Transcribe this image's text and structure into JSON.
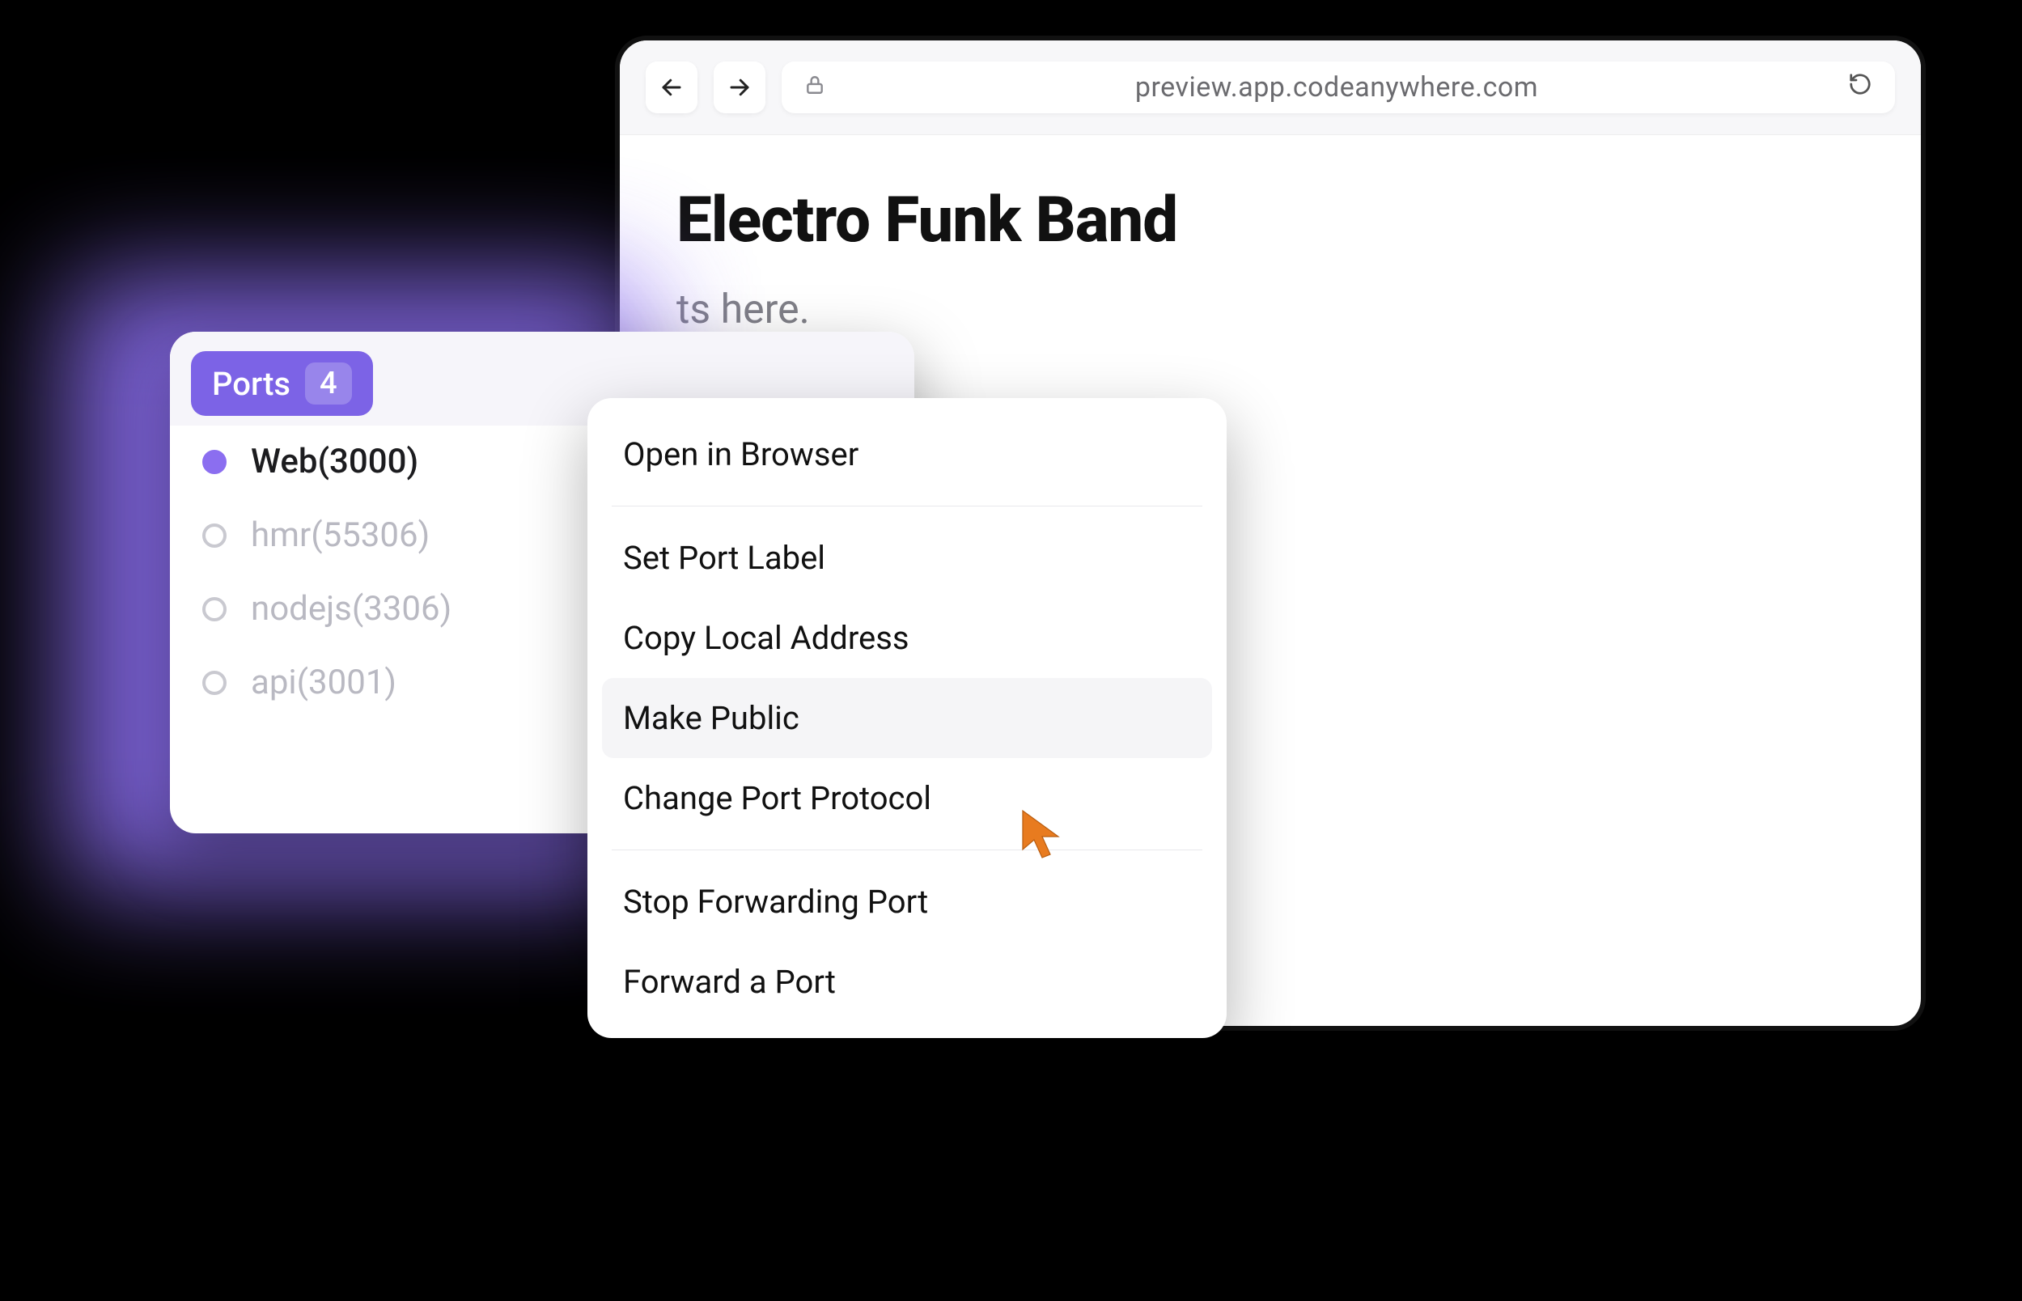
{
  "colors": {
    "accent": "#7c63e6",
    "glow": "#8b6ef0",
    "cursor": "#e87b1f"
  },
  "browser": {
    "url": "preview.app.codeanywhere.com",
    "page_title": "Electro Funk Band",
    "page_subtext_fragment": "ts here."
  },
  "ports_panel": {
    "tab_label": "Ports",
    "count": "4",
    "items": [
      {
        "label": "Web(3000)",
        "active": true
      },
      {
        "label": "hmr(55306)",
        "active": false
      },
      {
        "label": "nodejs(3306)",
        "active": false
      },
      {
        "label": "api(3001)",
        "active": false
      }
    ]
  },
  "context_menu": {
    "groups": [
      [
        "Open in Browser"
      ],
      [
        "Set Port Label",
        "Copy Local Address",
        "Make Public",
        "Change Port Protocol"
      ],
      [
        "Stop Forwarding Port",
        "Forward a Port"
      ]
    ],
    "hovered": "Make Public"
  }
}
